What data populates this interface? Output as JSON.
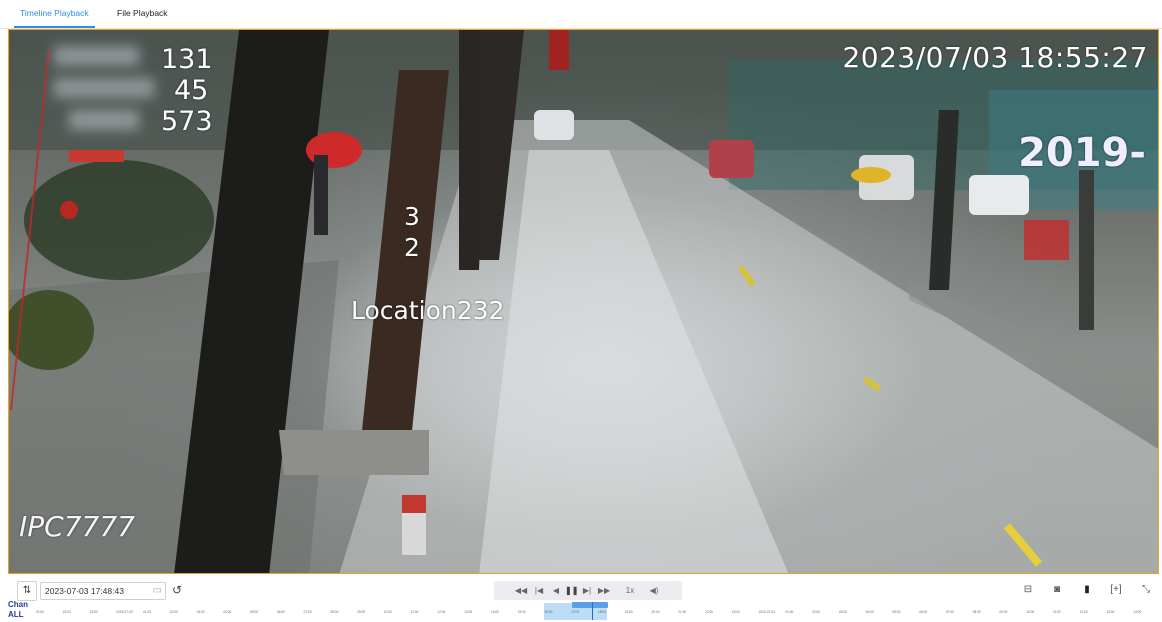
{
  "tabs": [
    {
      "label": "Timeline Playback",
      "active": true
    },
    {
      "label": "File Playback",
      "active": false
    }
  ],
  "video": {
    "timestamp": "2023/07/03 18:55:27",
    "overlay_numbers": [
      "131",
      "45",
      "573"
    ],
    "overlay_digits": [
      "3",
      "2"
    ],
    "location": "Location232",
    "camera_name": "IPC7777",
    "sign_text": "2019-",
    "border_color": "#f0a020"
  },
  "controls": {
    "date_value": "2023-07-03 17:48:43",
    "calendar_toggle_icon": "calendar-toggle-icon",
    "refresh_icon": "refresh-icon",
    "playback_buttons": [
      "rewind",
      "previous-frame",
      "slow",
      "pause",
      "next-frame",
      "fast-forward",
      "speed",
      "volume"
    ],
    "speed_label": "1x",
    "right_buttons": [
      "split-icon",
      "snapshot-icon",
      "bookmark-icon",
      "zoom-icon",
      "fullscreen-icon"
    ]
  },
  "timeline": {
    "chan_label": "Chan",
    "chan_value": "ALL",
    "ticks": [
      "21:00",
      "22:00",
      "23:00",
      "2023-07-03",
      "01:00",
      "02:00",
      "03:00",
      "04:00",
      "05:00",
      "06:00",
      "07:00",
      "08:00",
      "09:00",
      "10:00",
      "11:00",
      "12:00",
      "13:00",
      "14:00",
      "15:00",
      "16:00",
      "17:00",
      "18:00",
      "19:00",
      "20:00",
      "21:00",
      "22:00",
      "23:00",
      "2023-07-04",
      "01:00",
      "02:00",
      "03:00",
      "04:00",
      "05:00",
      "06:00",
      "07:00",
      "08:00",
      "09:00",
      "10:00",
      "11:00",
      "12:00",
      "13:00",
      "14:00"
    ],
    "accent_color": "#2d8cf0"
  }
}
